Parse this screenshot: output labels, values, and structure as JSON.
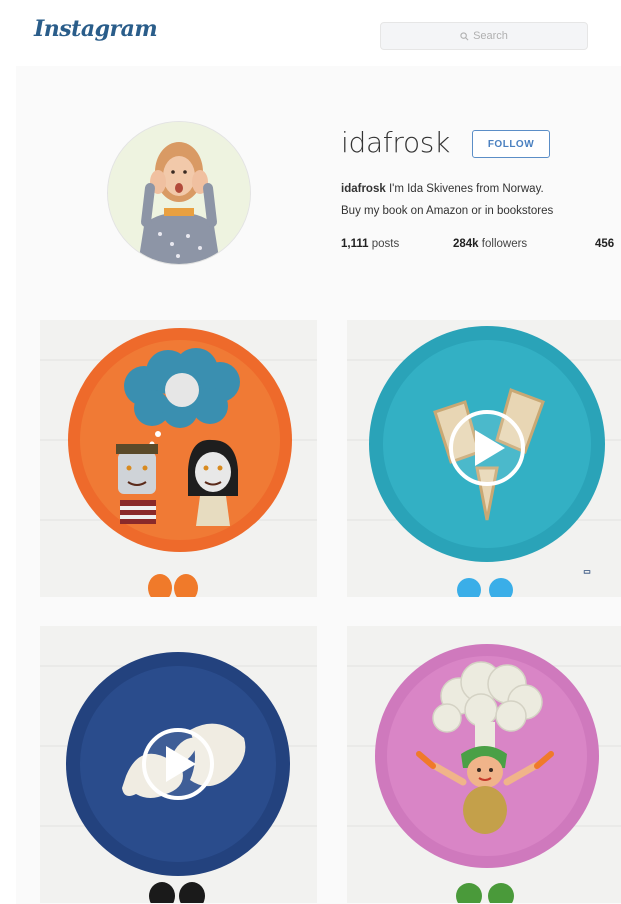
{
  "header": {
    "logo_text": "Instagram",
    "search_placeholder": "Search"
  },
  "profile": {
    "username": "idafrosk",
    "follow_label": "FOLLOW",
    "bio_name": "idafrosk",
    "bio_line1": " I'm Ida Skivenes from Norway.",
    "bio_line2": "Buy my book on Amazon or in bookstores",
    "stats": {
      "posts_count": "1,111",
      "posts_label": "posts",
      "followers_count": "284k",
      "followers_label": "followers",
      "following_count": "456"
    }
  },
  "colors": {
    "accent": "#4a80c0",
    "logo": "#2a5d8a",
    "plate_orange": "#ee6a2b",
    "plate_teal": "#2aa3b8",
    "plate_navy": "#23427e",
    "plate_pink": "#cf79bd"
  },
  "posts": [
    {
      "kind": "photo",
      "icon": "orange-plate-faces"
    },
    {
      "kind": "video",
      "icon": "teal-plate-sandwich"
    },
    {
      "kind": "video",
      "icon": "navy-plate-fish"
    },
    {
      "kind": "photo",
      "icon": "pink-plate-cauliflower-tree"
    }
  ]
}
